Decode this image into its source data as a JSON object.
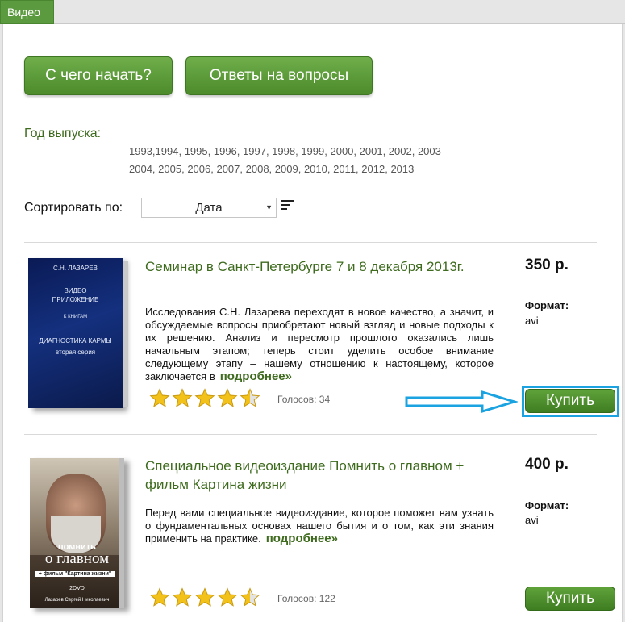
{
  "tab": {
    "label": "Видео"
  },
  "buttons": {
    "start": "С чего начать?",
    "faq": "Ответы на вопросы"
  },
  "filter": {
    "year_label": "Год выпуска",
    "year_label_colon": ":",
    "years_row1": [
      "1993,",
      "1994,",
      " 1995,",
      " 1996,",
      " 1997,",
      " 1998,",
      " 1999,",
      " 2000,",
      " 2001,",
      " 2002,",
      " 2003"
    ],
    "years_row2": [
      "2004,",
      " 2005,",
      " 2006,",
      " 2007,",
      " 2008,",
      " 2009,",
      " 2010,",
      " 2011,",
      " 2012,",
      " 2013"
    ]
  },
  "sort": {
    "label": "Сортировать по:",
    "selected": "Дата"
  },
  "products": [
    {
      "title": "Семинар в Санкт-Петербурге 7 и 8 декабря 2013г.",
      "description": "Исследования С.Н. Лазарева переходят в новое качество, а значит, и обсуждаемые вопросы приобретают новый взгляд и новые подходы к их решению. Анализ и пересмотр прошлого оказались лишь начальным этапом; теперь стоит уделить особое внимание следующему этапу – нашему отношению к настоящему, которое заключается в",
      "more": "подробнее»",
      "votes": "Голосов: 34",
      "rating": 4.5,
      "price": "350 р.",
      "format_label": "Формат:",
      "format_value": "avi",
      "buy": "Купить",
      "cover": {
        "author": "С.Н. ЛАЗАРЕВ",
        "line1": "ВИДЕО",
        "line2": "ПРИЛОЖЕНИЕ",
        "line3": "К КНИГАМ",
        "line4": "ДИАГНОСТИКА КАРМЫ",
        "line5": "вторая серия"
      }
    },
    {
      "title": "Специальное видеоиздание Помнить о главном + фильм Картина жизни",
      "description": "Перед вами специальное видеоиздание, которое поможет вам узнать о фундаментальных основах нашего бытия и о том, как эти знания применить на практике.",
      "more": "подробнее»",
      "votes": "Голосов: 122",
      "rating": 4.5,
      "price": "400 р.",
      "format_label": "Формат:",
      "format_value": "avi",
      "buy": "Купить",
      "cover": {
        "line1": "помнить",
        "line2": "о главном",
        "line3": "+ фильм \"Картина жизни\"",
        "line4": "2DVD",
        "line5": "Лазарев Сергей Николаевич"
      }
    }
  ],
  "colors": {
    "accent": "#5b9a3f",
    "link": "#3e6b1e",
    "highlight": "#1aa3e0"
  },
  "icons": {
    "sort": "sort-lines-icon",
    "star": "star-icon",
    "arrow": "right-arrow-icon"
  }
}
